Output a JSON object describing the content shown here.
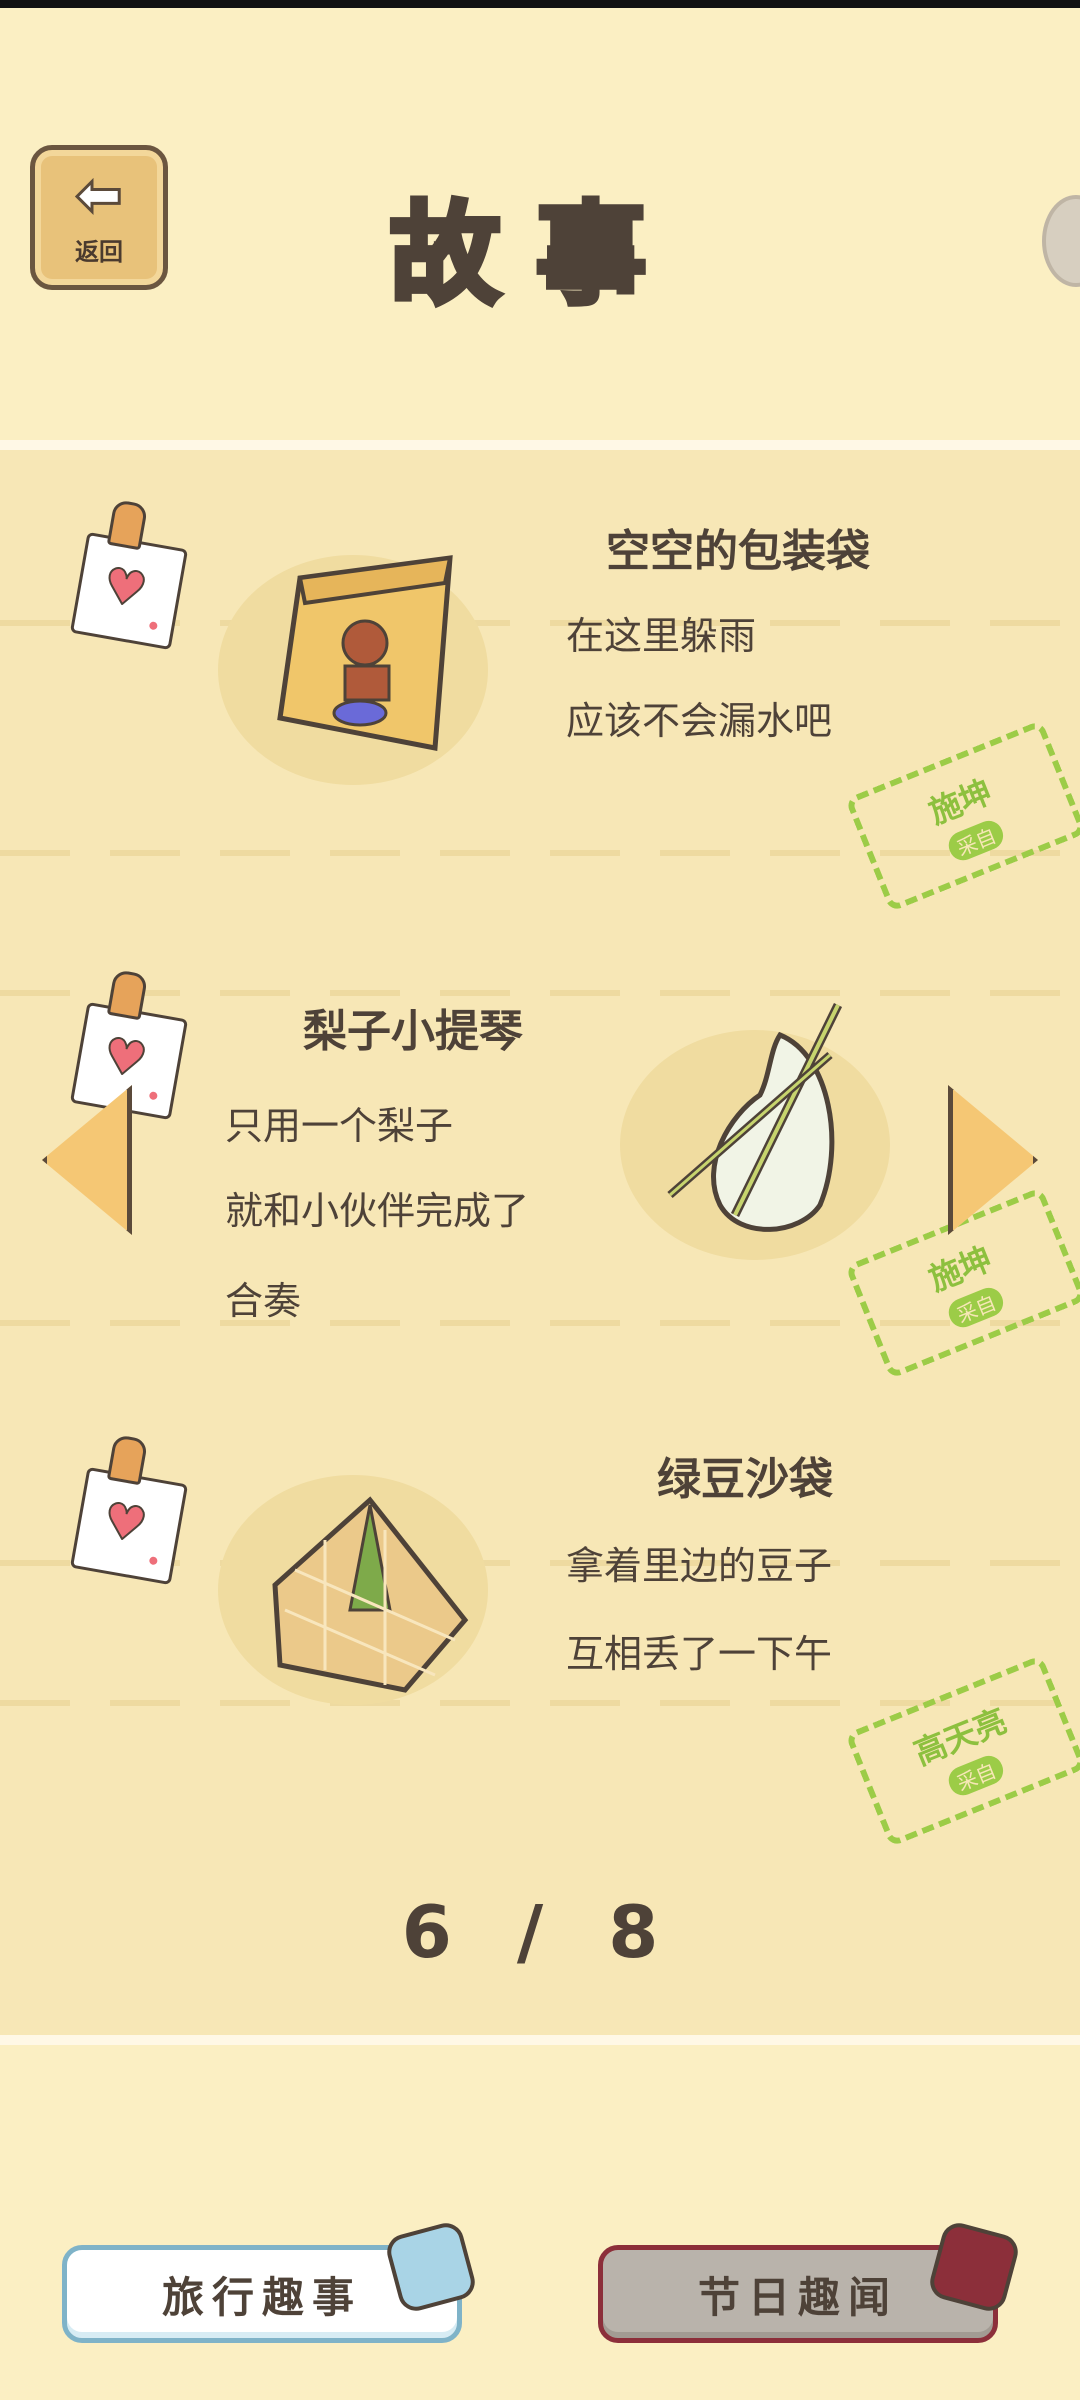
{
  "header": {
    "back_label": "返回",
    "title": "故事"
  },
  "entries": [
    {
      "title": "空空的包装袋",
      "lines": [
        "在这里躲雨",
        "应该不会漏水吧"
      ],
      "stamp": {
        "name": "施坤",
        "sub": "采自"
      }
    },
    {
      "title": "梨子小提琴",
      "lines": [
        "只用一个梨子",
        "就和小伙伴完成了",
        "合奏"
      ],
      "stamp": {
        "name": "施坤",
        "sub": "采自"
      }
    },
    {
      "title": "绿豆沙袋",
      "lines": [
        "拿着里边的豆子",
        "互相丢了一下午"
      ],
      "stamp": {
        "name": "高天亮",
        "sub": "采自"
      }
    }
  ],
  "pager": "6 / 8",
  "bottom": {
    "travel_label": "旅行趣事",
    "festival_label": "节日趣闻"
  },
  "colors": {
    "background": "#fbefc3",
    "panel": "#f7e7b6",
    "stamp_green": "#8dc03e",
    "heart_pink": "#ee6f7a"
  }
}
